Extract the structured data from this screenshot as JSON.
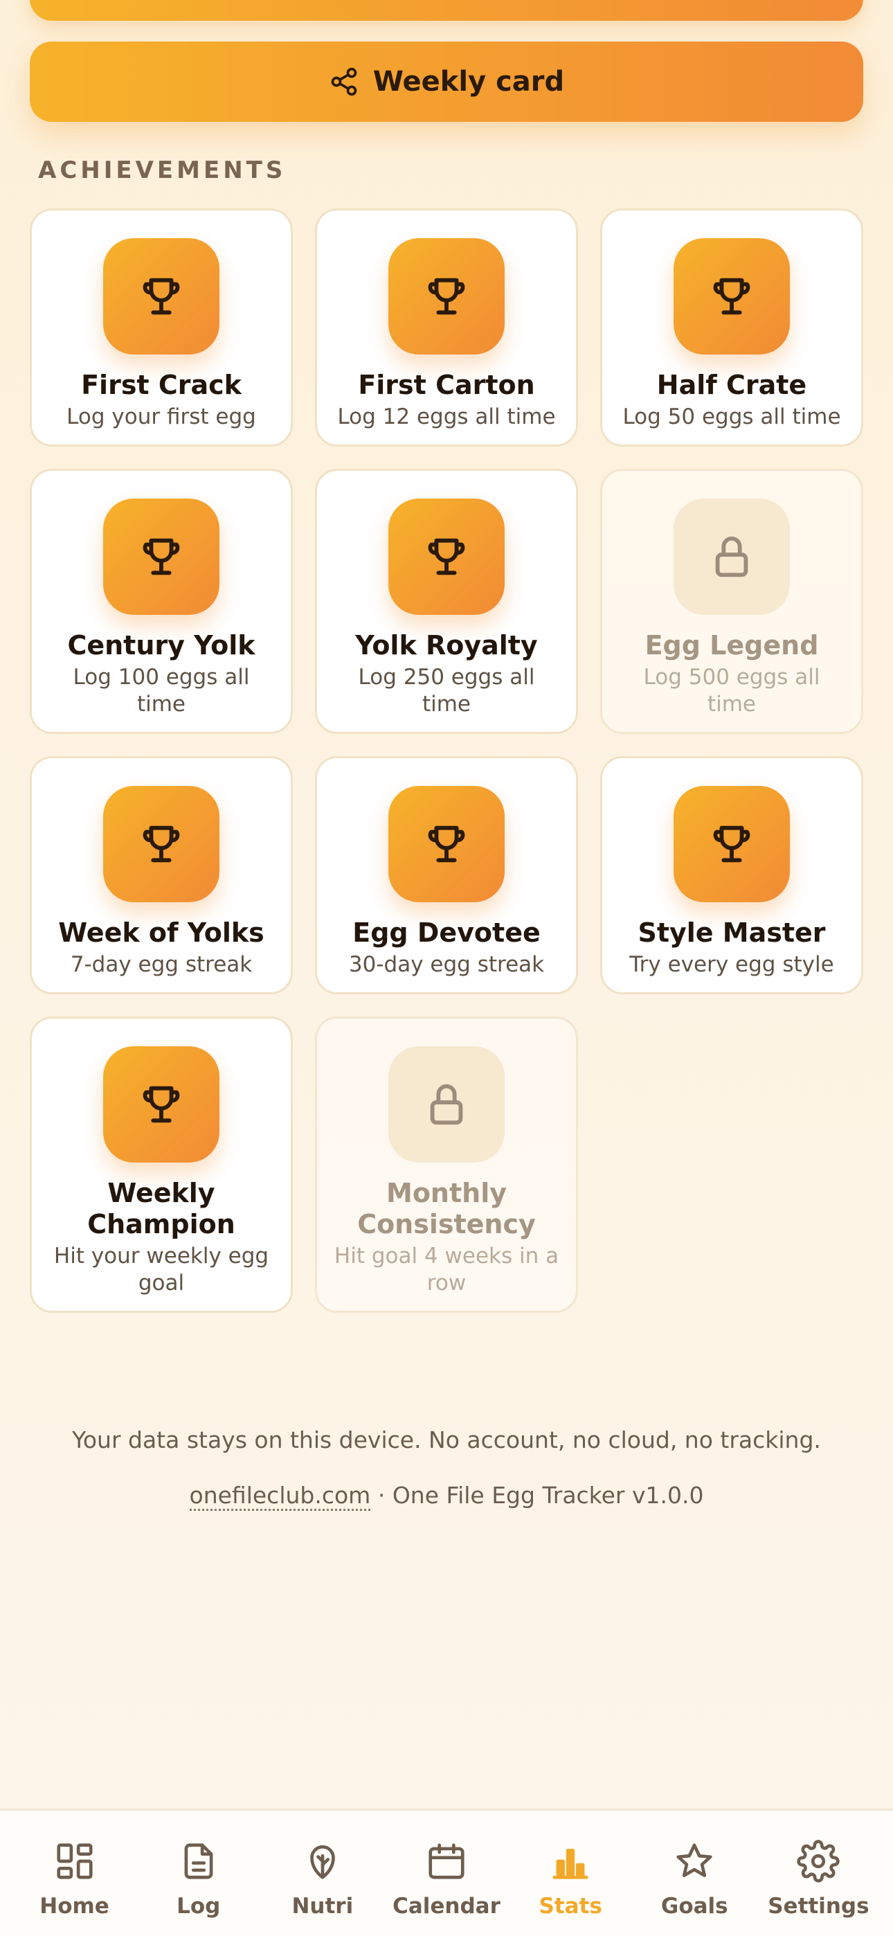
{
  "weekly_card_label": "Weekly card",
  "section_title": "ACHIEVEMENTS",
  "achievements": [
    {
      "title": "First Crack",
      "desc": "Log your first egg",
      "unlocked": true
    },
    {
      "title": "First Carton",
      "desc": "Log 12 eggs all time",
      "unlocked": true
    },
    {
      "title": "Half Crate",
      "desc": "Log 50 eggs all time",
      "unlocked": true
    },
    {
      "title": "Century Yolk",
      "desc": "Log 100 eggs all time",
      "unlocked": true
    },
    {
      "title": "Yolk Royalty",
      "desc": "Log 250 eggs all time",
      "unlocked": true
    },
    {
      "title": "Egg Legend",
      "desc": "Log 500 eggs all time",
      "unlocked": false
    },
    {
      "title": "Week of Yolks",
      "desc": "7-day egg streak",
      "unlocked": true
    },
    {
      "title": "Egg Devotee",
      "desc": "30-day egg streak",
      "unlocked": true
    },
    {
      "title": "Style Master",
      "desc": "Try every egg style",
      "unlocked": true
    },
    {
      "title": "Weekly Champion",
      "desc": "Hit your weekly egg goal",
      "unlocked": true
    },
    {
      "title": "Monthly Consistency",
      "desc": "Hit goal 4 weeks in a row",
      "unlocked": false
    }
  ],
  "footer": {
    "privacy": "Your data stays on this device. No account, no cloud, no tracking.",
    "link": "onefileclub.com",
    "separator": " · ",
    "app_version": "One File Egg Tracker v1.0.0"
  },
  "tabs": [
    {
      "label": "Home",
      "icon": "home-grid-icon",
      "active": false
    },
    {
      "label": "Log",
      "icon": "document-icon",
      "active": false
    },
    {
      "label": "Nutri",
      "icon": "leaf-icon",
      "active": false
    },
    {
      "label": "Calendar",
      "icon": "calendar-icon",
      "active": false
    },
    {
      "label": "Stats",
      "icon": "bar-chart-icon",
      "active": true
    },
    {
      "label": "Goals",
      "icon": "star-icon",
      "active": false
    },
    {
      "label": "Settings",
      "icon": "gear-icon",
      "active": false
    }
  ],
  "colors": {
    "accent_start": "#f6b22a",
    "accent_end": "#f28b36",
    "active_tab": "#f2a92a"
  }
}
